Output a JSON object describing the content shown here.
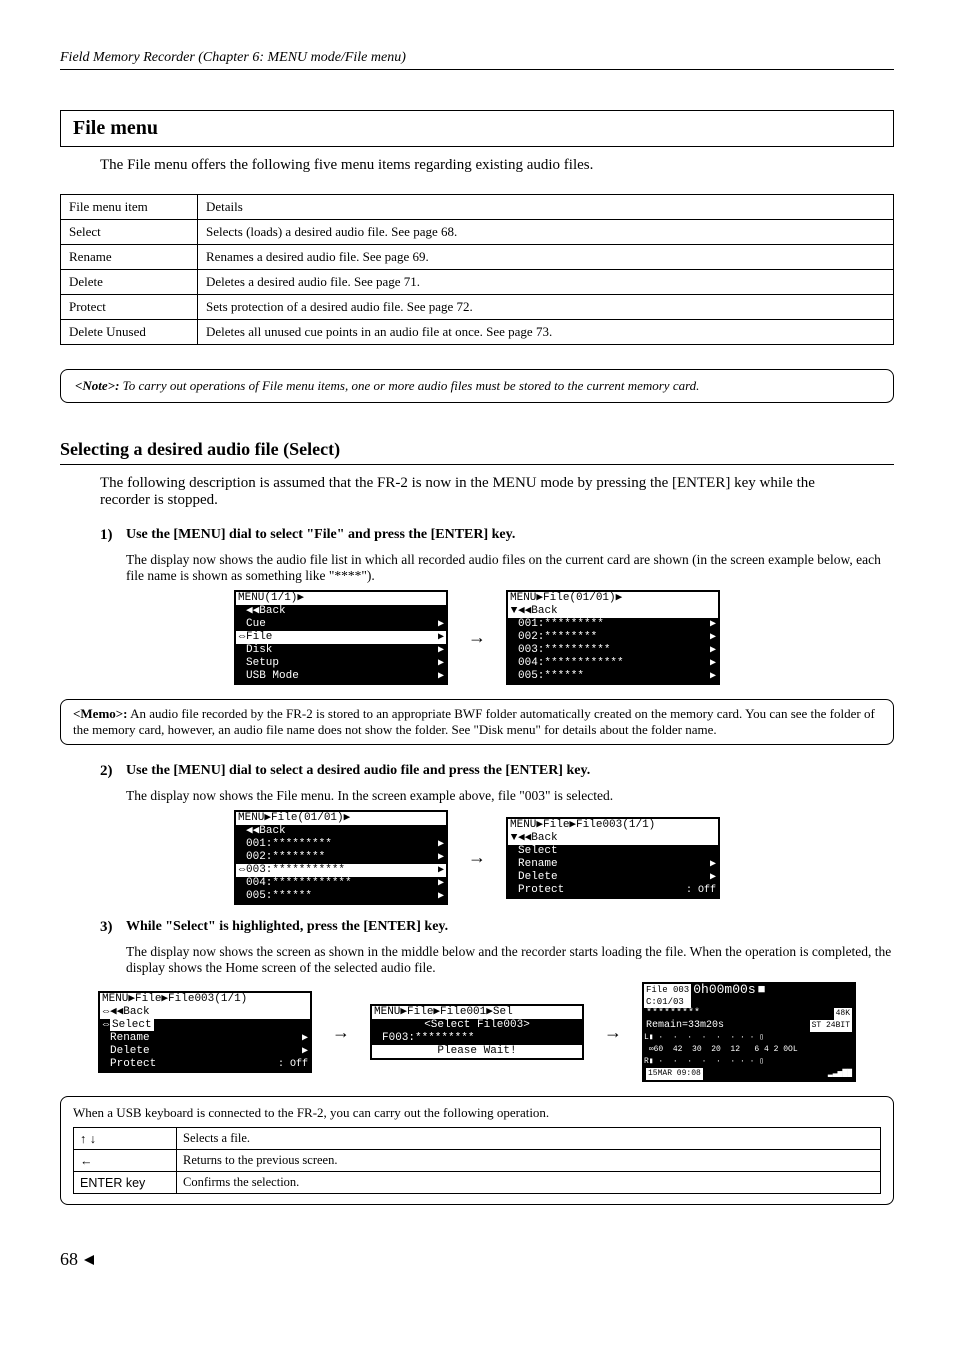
{
  "header": "Field Memory Recorder (Chapter 6: MENU mode/File menu)",
  "title": "File menu",
  "intro": "The File menu offers the following five menu items regarding existing audio files.",
  "items_table": {
    "headers": [
      "File menu item",
      "Details"
    ],
    "rows": [
      {
        "item": "Select",
        "details": "Selects (loads) a desired audio file. See page 68."
      },
      {
        "item": "Rename",
        "details": "Renames a desired audio file. See page 69."
      },
      {
        "item": "Delete",
        "details": "Deletes a desired audio file. See page 71."
      },
      {
        "item": "Protect",
        "details": "Sets protection of a desired audio file. See page 72."
      },
      {
        "item": "Delete Unused",
        "details": "Deletes all unused cue points in an audio file at once. See page 73."
      }
    ]
  },
  "note": {
    "label": "<Note>:",
    "text": "To carry out operations of File menu items, one or more audio files must be stored to the current memory card."
  },
  "section": {
    "heading": "Selecting a desired audio file (Select)",
    "intro": "The following description is assumed that the FR-2 is now in the MENU mode by pressing the [ENTER] key while the recorder is stopped."
  },
  "steps": {
    "s1": {
      "num": "1)",
      "bold": "Use the [MENU] dial to select \"File\" and press the [ENTER] key.",
      "sub": "The display now shows the audio file list in which all recorded audio files on the current card are shown (in the screen example below, each file name is shown as something like \"****\")."
    },
    "s2": {
      "num": "2)",
      "bold": "Use the [MENU] dial to select a desired audio file and press the [ENTER] key.",
      "sub": "The display now shows the File menu. In the screen example above, file \"003\" is selected."
    },
    "s3": {
      "num": "3)",
      "bold": "While \"Select\" is highlighted, press the [ENTER] key.",
      "sub": "The display now shows the screen as shown in the middle below and the recorder starts loading the file. When the operation is completed, the display shows the Home screen of the selected audio file."
    }
  },
  "lcd1": {
    "left": {
      "title": "MENU(1/1)▶",
      "rows": [
        {
          "t": "◀◀Back",
          "a": ""
        },
        {
          "t": "Cue",
          "a": "▶"
        },
        {
          "t": "File",
          "a": "▶",
          "hl": true
        },
        {
          "t": "Disk",
          "a": "▶"
        },
        {
          "t": "Setup",
          "a": "▶"
        },
        {
          "t": "USB Mode",
          "a": "▶"
        }
      ]
    },
    "right": {
      "title": "MENU▶File(01/01)▶",
      "rows": [
        {
          "t": "◀◀Back",
          "a": "",
          "hl": true,
          "mark": "▼"
        },
        {
          "t": "001:*********",
          "a": "▶"
        },
        {
          "t": "002:********",
          "a": "▶"
        },
        {
          "t": "003:**********",
          "a": "▶"
        },
        {
          "t": "004:************",
          "a": "▶"
        },
        {
          "t": "005:******",
          "a": "▶"
        }
      ]
    }
  },
  "memo": {
    "label": "<Memo>:",
    "text": "An audio file recorded by the FR-2 is stored to an appropriate BWF folder automatically created on the memory card. You can see the folder of the memory card, however, an audio file name does not show the folder. See \"Disk menu\" for details about the folder name."
  },
  "lcd2": {
    "left": {
      "title": "MENU▶File(01/01)▶",
      "rows": [
        {
          "t": "◀◀Back",
          "a": ""
        },
        {
          "t": "001:*********",
          "a": "▶"
        },
        {
          "t": "002:********",
          "a": "▶"
        },
        {
          "t": "003:***********",
          "a": "▶",
          "hl": true
        },
        {
          "t": "004:************",
          "a": "▶"
        },
        {
          "t": "005:******",
          "a": "▶"
        }
      ]
    },
    "right": {
      "title": "MENU▶File▶File003(1/1)",
      "rows": [
        {
          "t": "◀◀Back",
          "a": "",
          "hl": true,
          "mark": "▼"
        },
        {
          "t": "Select",
          "a": ""
        },
        {
          "t": "Rename",
          "a": "▶"
        },
        {
          "t": "Delete",
          "a": "▶"
        },
        {
          "t": "Protect",
          "a": ": Off"
        }
      ]
    }
  },
  "lcd3": {
    "a": {
      "title": "MENU▶File▶File003(1/1)",
      "rows": [
        {
          "t": "◀◀Back",
          "a": "",
          "hl": true
        },
        {
          "t": "Select",
          "a": "",
          "sel": true
        },
        {
          "t": "Rename",
          "a": "▶"
        },
        {
          "t": "Delete",
          "a": "▶"
        },
        {
          "t": "Protect",
          "a": ": Off"
        }
      ]
    },
    "b": {
      "title": "MENU▶File▶File001▶Sel",
      "line1": "<Select File003>",
      "line2": "F003:*********",
      "wait": "Please Wait!"
    },
    "home": {
      "file": "File 003",
      "cue": "C:01/03",
      "time": "0h00m00s",
      "name": "*********",
      "fs": "48K",
      "remain": "Remain=33m20s",
      "mode": "ST 24BIT",
      "scale": "∞60  42  30  20  12   6 4 2 0OL",
      "date": "15MAR 09:08"
    }
  },
  "kb": {
    "intro": "When a USB keyboard is connected to the FR-2, you can carry out the following operation.",
    "rows": [
      {
        "key": "↑ ↓",
        "desc": "Selects a file."
      },
      {
        "key": "←",
        "desc": "Returns to the previous screen."
      },
      {
        "key": "ENTER key",
        "desc": "Confirms the selection."
      }
    ]
  },
  "page": "68"
}
